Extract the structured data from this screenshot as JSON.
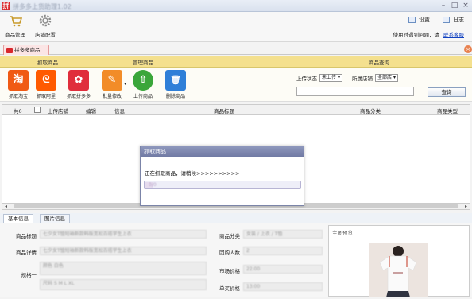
{
  "window": {
    "title": "拼多多上货助理1.02",
    "icon_text": "拼"
  },
  "toolbar": {
    "items": [
      {
        "label": "商品管理",
        "icon": "cart-icon"
      },
      {
        "label": "店铺配置",
        "icon": "gear-icon"
      }
    ],
    "settings_label": "设置",
    "log_label": "日志",
    "help_text": "使用时遇到问题，请",
    "help_link": "联系客服"
  },
  "doc_tab": {
    "label": "拼多多商品"
  },
  "groups": {
    "fetch": "抓取商品",
    "manage": "管理商品",
    "query": "商品查询"
  },
  "actions": [
    {
      "label": "抓取淘宝",
      "icon": "taobao-icon",
      "glyph": "淘",
      "color": "#f05a14"
    },
    {
      "label": "抓取阿里",
      "icon": "alibaba-icon",
      "glyph": "ᘓ",
      "color": "#ff5a00"
    },
    {
      "label": "抓取拼多多",
      "icon": "pinduoduo-icon",
      "glyph": "✿",
      "color": "#e02e3c"
    },
    {
      "label": "批量修改",
      "icon": "pencil-icon",
      "glyph": "✎",
      "color": "#f28c28"
    },
    {
      "label": "上传商品",
      "icon": "upload-icon",
      "glyph": "⇧",
      "color": "#3aa63a"
    },
    {
      "label": "删除商品",
      "icon": "trash-icon",
      "glyph": "🗑",
      "color": "#2f7fd8"
    }
  ],
  "query": {
    "upload_status_label": "上传状态",
    "upload_status_value": "未上传",
    "shop_label": "所属店铺",
    "shop_value": "全部店",
    "search_value": "",
    "query_button": "查询"
  },
  "grid": {
    "columns": [
      "共0",
      "上传店铺",
      "编辑",
      "信息",
      "商品标题",
      "商品分类",
      "商品类型"
    ]
  },
  "detail": {
    "tabs": [
      "基本信息",
      "图片信息"
    ],
    "fields": {
      "title_label": "商品标题",
      "title_value": "七夕女T恤短袖新款韩版宽松百搭学生上衣",
      "desc_label": "商品详情",
      "desc_value": "七夕女T恤短袖新款韩版宽松百搭学生上衣",
      "line1_label": "规格一",
      "line1_value": "颜色 白色",
      "line2_value": "尺码 S M L XL",
      "category_label": "商品分类",
      "category_value": "女装 / 上衣 / T恤",
      "group_label": "团购人数",
      "group_value": "2",
      "market_label": "市场价格",
      "market_value": "22.00",
      "single_label": "单买价格",
      "single_value": "13.00"
    },
    "main_image_label": "主图预览"
  },
  "dialog": {
    "title": "抓取商品",
    "message": "正在抓取商品，请稍候>>>>>>>>>>",
    "progress_text": "0/0",
    "progress": 0.05
  }
}
